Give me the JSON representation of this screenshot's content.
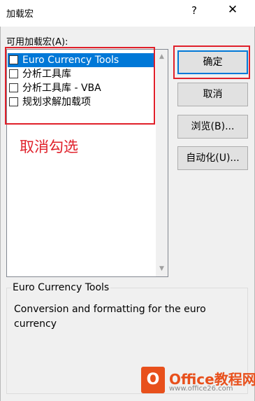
{
  "window": {
    "title": "加载宏",
    "help_label": "?",
    "close_label": "✕"
  },
  "addins": {
    "label": "可用加载宏(A):",
    "items": [
      {
        "label": "Euro Currency Tools",
        "checked": false,
        "selected": true
      },
      {
        "label": "分析工具库",
        "checked": false,
        "selected": false
      },
      {
        "label": "分析工具库 - VBA",
        "checked": false,
        "selected": false
      },
      {
        "label": "规划求解加载项",
        "checked": false,
        "selected": false
      }
    ]
  },
  "buttons": {
    "ok": "确定",
    "cancel": "取消",
    "browse": "浏览(B)...",
    "automation": "自动化(U)..."
  },
  "annotation": {
    "text": "取消勾选",
    "color": "#e0202a"
  },
  "description": {
    "name": "Euro Currency Tools",
    "text": "Conversion and formatting for the euro currency"
  },
  "watermark": {
    "brand": "Office教程网",
    "url": "www.office26.com"
  },
  "colors": {
    "accent": "#0078d7",
    "highlight": "#e0202a",
    "brand": "#e8501c"
  }
}
